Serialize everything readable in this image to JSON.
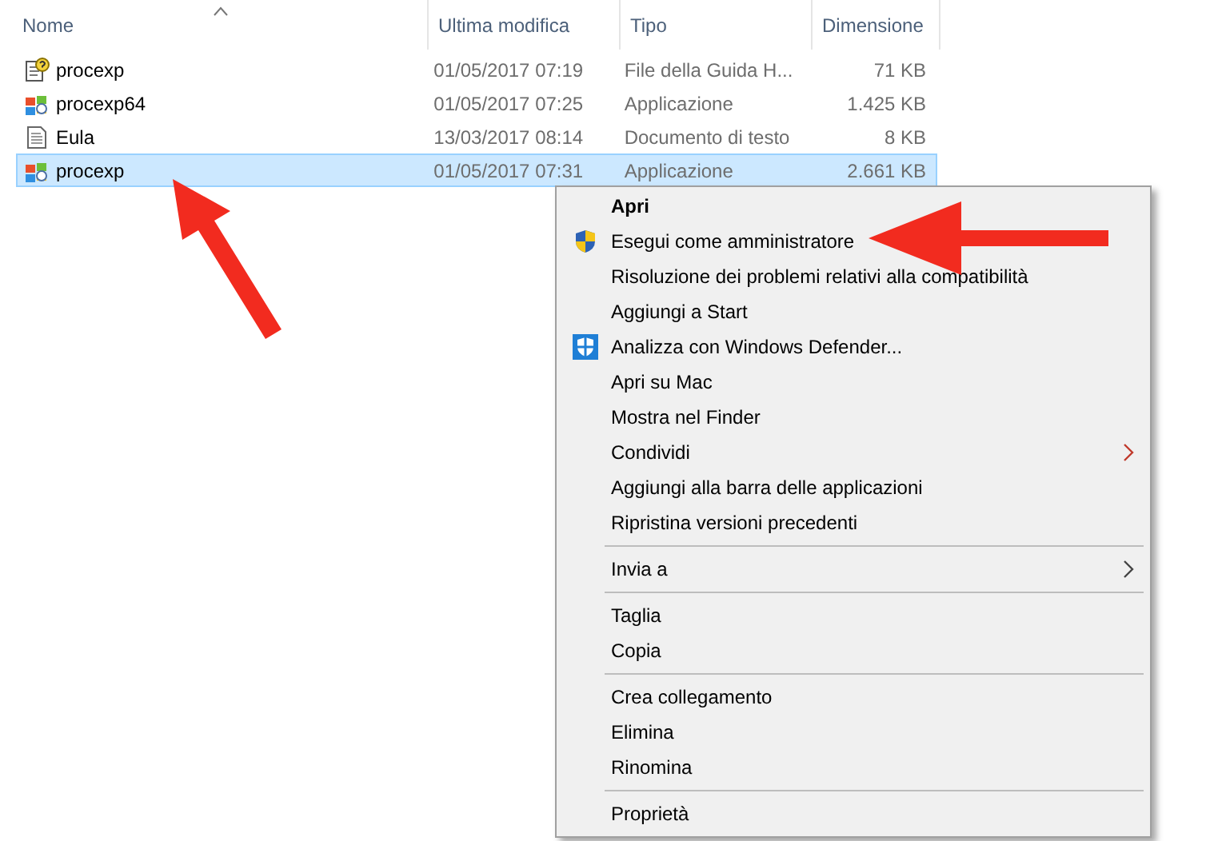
{
  "columns": [
    {
      "label": "Nome",
      "sorted": true
    },
    {
      "label": "Ultima modifica",
      "sorted": false
    },
    {
      "label": "Tipo",
      "sorted": false
    },
    {
      "label": "Dimensione",
      "sorted": false
    }
  ],
  "files": [
    {
      "name": "procexp",
      "modified": "01/05/2017 07:19",
      "type": "File della Guida H...",
      "size": "71 KB",
      "kind": "help",
      "selected": false
    },
    {
      "name": "procexp64",
      "modified": "01/05/2017 07:25",
      "type": "Applicazione",
      "size": "1.425 KB",
      "kind": "app",
      "selected": false
    },
    {
      "name": "Eula",
      "modified": "13/03/2017 08:14",
      "type": "Documento di testo",
      "size": "8 KB",
      "kind": "text",
      "selected": false
    },
    {
      "name": "procexp",
      "modified": "01/05/2017 07:31",
      "type": "Applicazione",
      "size": "2.661 KB",
      "kind": "app",
      "selected": true
    }
  ],
  "context_menu": [
    {
      "kind": "item",
      "label": "Apri",
      "default": true
    },
    {
      "kind": "admin",
      "label": "Esegui come amministratore"
    },
    {
      "kind": "item",
      "label": "Risoluzione dei problemi relativi alla compatibilità"
    },
    {
      "kind": "item",
      "label": "Aggiungi a Start"
    },
    {
      "kind": "scan",
      "label": "Analizza con Windows Defender..."
    },
    {
      "kind": "item",
      "label": "Apri su Mac"
    },
    {
      "kind": "item",
      "label": "Mostra nel Finder"
    },
    {
      "kind": "item",
      "label": "Condividi",
      "submenu": true
    },
    {
      "kind": "item",
      "label": "Aggiungi alla barra delle applicazioni"
    },
    {
      "kind": "item",
      "label": "Ripristina versioni precedenti"
    },
    {
      "kind": "separator"
    },
    {
      "kind": "item",
      "label": "Invia a",
      "submenu": true
    },
    {
      "kind": "separator"
    },
    {
      "kind": "item",
      "label": "Taglia"
    },
    {
      "kind": "item",
      "label": "Copia"
    },
    {
      "kind": "separator"
    },
    {
      "kind": "item",
      "label": "Crea collegamento"
    },
    {
      "kind": "item",
      "label": "Elimina"
    },
    {
      "kind": "item",
      "label": "Rinomina"
    },
    {
      "kind": "separator"
    },
    {
      "kind": "item",
      "label": "Proprietà"
    }
  ]
}
